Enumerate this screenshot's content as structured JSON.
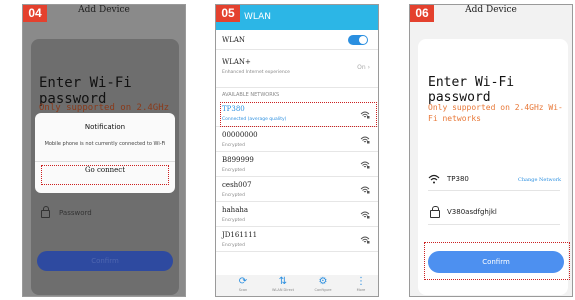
{
  "steps": [
    "04",
    "05",
    "06"
  ],
  "panel1": {
    "header": "Add Device",
    "title": "Enter Wi-Fi password",
    "only": "Only supported on 2.4GHz Wi-Fi",
    "password_placeholder": "Password",
    "confirm": "Confirm",
    "notification": {
      "title": "Notification",
      "message": "Mobile phone is not currently connected to Wi-Fi",
      "button": "Go connect"
    }
  },
  "panel2": {
    "bar_title": "WLAN",
    "wlan_label": "WLAN",
    "wlan_plus": "WLAN+",
    "wlan_plus_sub": "Enhanced Internet experience",
    "wlan_plus_state": "On",
    "section": "AVAILABLE NETWORKS",
    "networks": [
      {
        "name": "TP380",
        "status": "Connected (average quality)"
      },
      {
        "name": "00000000",
        "status": "Encrypted"
      },
      {
        "name": "B899999",
        "status": "Encrypted"
      },
      {
        "name": "cesh007",
        "status": "Encrypted"
      },
      {
        "name": "hahaha",
        "status": "Encrypted"
      },
      {
        "name": "JD161111",
        "status": "Encrypted"
      }
    ],
    "nav": [
      "Scan",
      "WLAN Direct",
      "Configure",
      "More"
    ]
  },
  "panel3": {
    "header": "Add Device",
    "title": "Enter Wi-Fi password",
    "only": "Only supported on 2.4GHz Wi-Fi networks",
    "ssid": "TP380",
    "change": "Change Network",
    "password": "V380asdfghjkl",
    "confirm": "Confirm"
  },
  "colors": {
    "step": "#e4412e",
    "accent": "#2b8fe0",
    "highlight": "#cc2020",
    "wlan_bar": "#2cb6e6"
  }
}
